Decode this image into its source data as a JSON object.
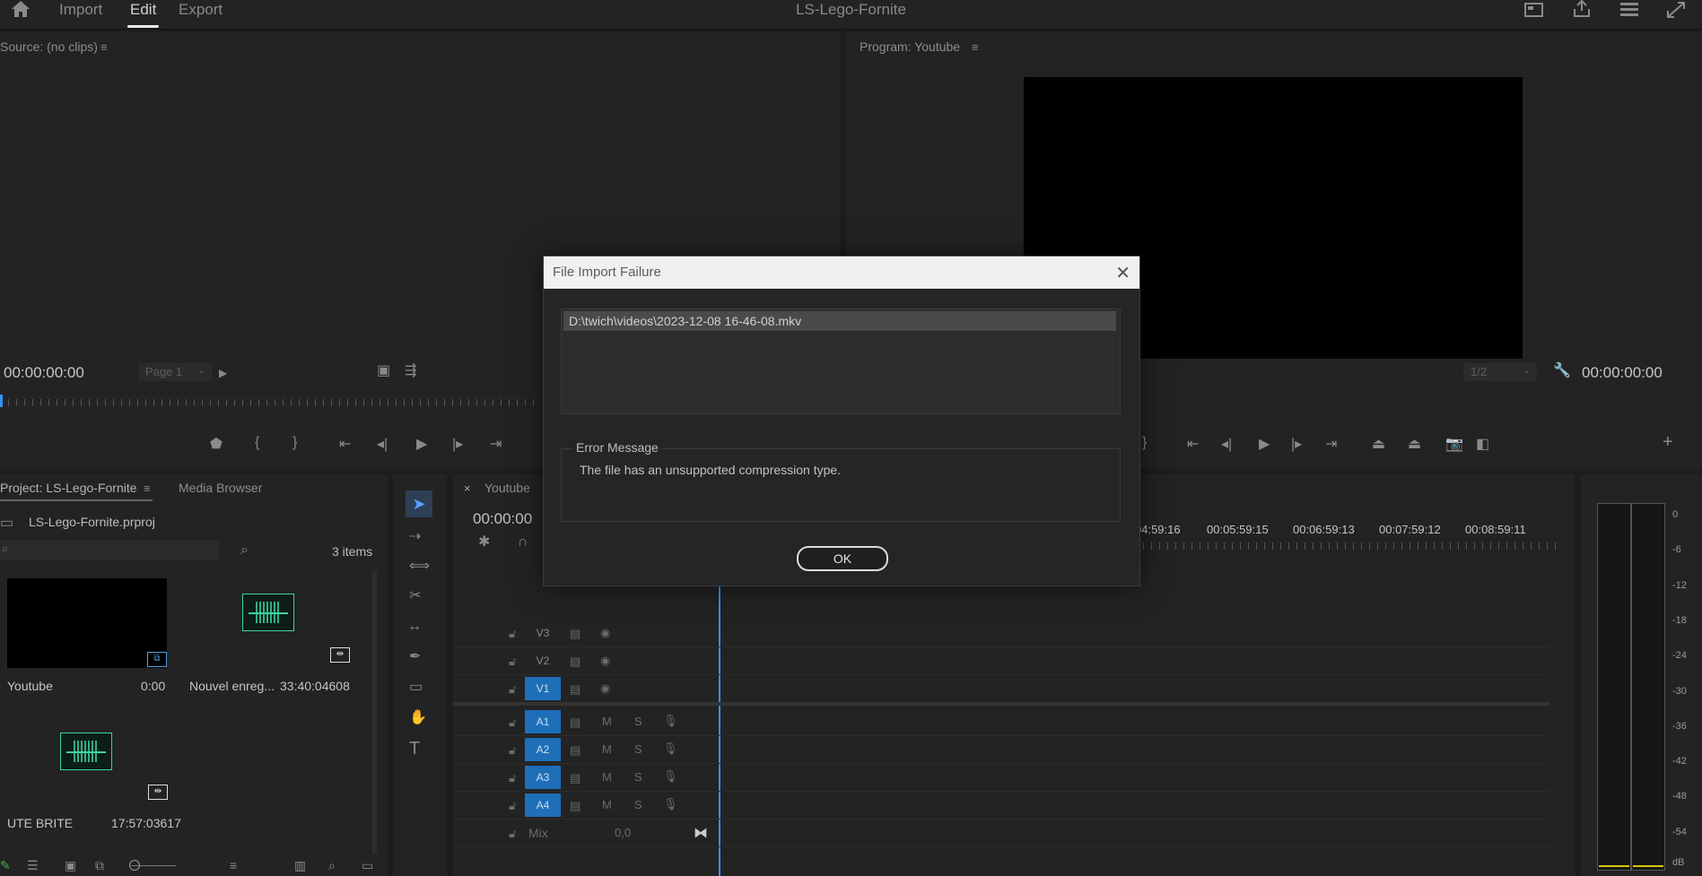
{
  "topbar": {
    "tabs": [
      {
        "label": "Import"
      },
      {
        "label": "Edit"
      },
      {
        "label": "Export"
      }
    ],
    "active_tab": "Edit",
    "title": "LS-Lego-Fornite"
  },
  "source": {
    "title": "Source: (no clips)",
    "timecode": "00:00:00:00",
    "page_select": "Page 1"
  },
  "program": {
    "title": "Program: Youtube",
    "timecode": "00:00:00:00",
    "resolution": "1/2"
  },
  "project": {
    "tab_label": "Project: LS-Lego-Fornite",
    "media_browser_label": "Media Browser",
    "file_name": "LS-Lego-Fornite.prproj",
    "item_count": "3 items",
    "items": [
      {
        "name": "Youtube",
        "duration": "0:00"
      },
      {
        "name": "Nouvel enreg...",
        "duration": "33:40:04608"
      },
      {
        "name": "UTE BRITE",
        "duration": "17:57:03617"
      }
    ]
  },
  "timeline": {
    "tab_label": "Youtube",
    "timecode": "00:00:00",
    "ruler": [
      "04:59:16",
      "00:05:59:15",
      "00:06:59:13",
      "00:07:59:12",
      "00:08:59:11"
    ],
    "video_tracks": [
      "V3",
      "V2",
      "V1"
    ],
    "audio_tracks": [
      "A1",
      "A2",
      "A3",
      "A4"
    ],
    "mix_label": "Mix",
    "mix_value": "0,0",
    "m_label": "M",
    "s_label": "S"
  },
  "meter": {
    "labels": [
      "0",
      "-6",
      "-12",
      "-18",
      "-24",
      "-30",
      "-36",
      "-42",
      "-48",
      "-54",
      "dB"
    ]
  },
  "dialog": {
    "title": "File Import Failure",
    "file_path": "D:\\twich\\videos\\2023-12-08 16-46-08.mkv",
    "error_label": "Error Message",
    "error_text": "The file has an unsupported compression type.",
    "ok_label": "OK"
  }
}
